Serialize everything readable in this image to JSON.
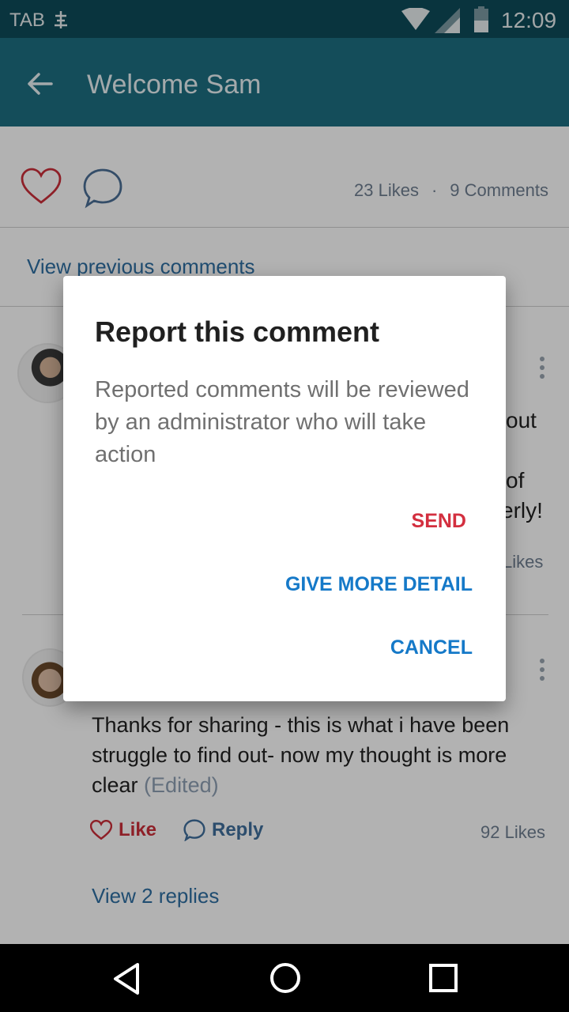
{
  "status_bar": {
    "carrier": "TAB",
    "time": "12:09",
    "icons": [
      "signal-icon",
      "wifi-icon",
      "cell-icon",
      "battery-icon"
    ]
  },
  "app_bar": {
    "back_icon": "arrow-left-icon",
    "title": "Welcome Sam"
  },
  "post": {
    "likes_text": "23 Likes",
    "separator": "·",
    "comments_text": "9 Comments",
    "view_previous": "View previous comments"
  },
  "comment1": {
    "fragment1": "out",
    "fragment2": "of",
    "fragment3": "erly!",
    "likes_text": "Likes"
  },
  "comment2": {
    "text": "Thanks for sharing - this is what i have been struggle to find out- now my thought is more clear",
    "edited": "(Edited)",
    "like_label": "Like",
    "reply_label": "Reply",
    "likes_text": "92 Likes",
    "view_replies": "View 2 replies"
  },
  "dialog": {
    "title": "Report this comment",
    "body": "Reported comments will be reviewed by an administrator who will take action",
    "send_label": "SEND",
    "detail_label": "GIVE MORE DETAIL",
    "cancel_label": "CANCEL"
  },
  "colors": {
    "status_bar": "#0d4b5a",
    "app_bar": "#1e6f82",
    "send": "#d32f3f",
    "accent_blue": "#1579c8",
    "like_red": "#cc2f3a"
  },
  "nav_bar": {
    "icons": [
      "triangle-back-icon",
      "circle-home-icon",
      "square-recent-icon"
    ]
  }
}
